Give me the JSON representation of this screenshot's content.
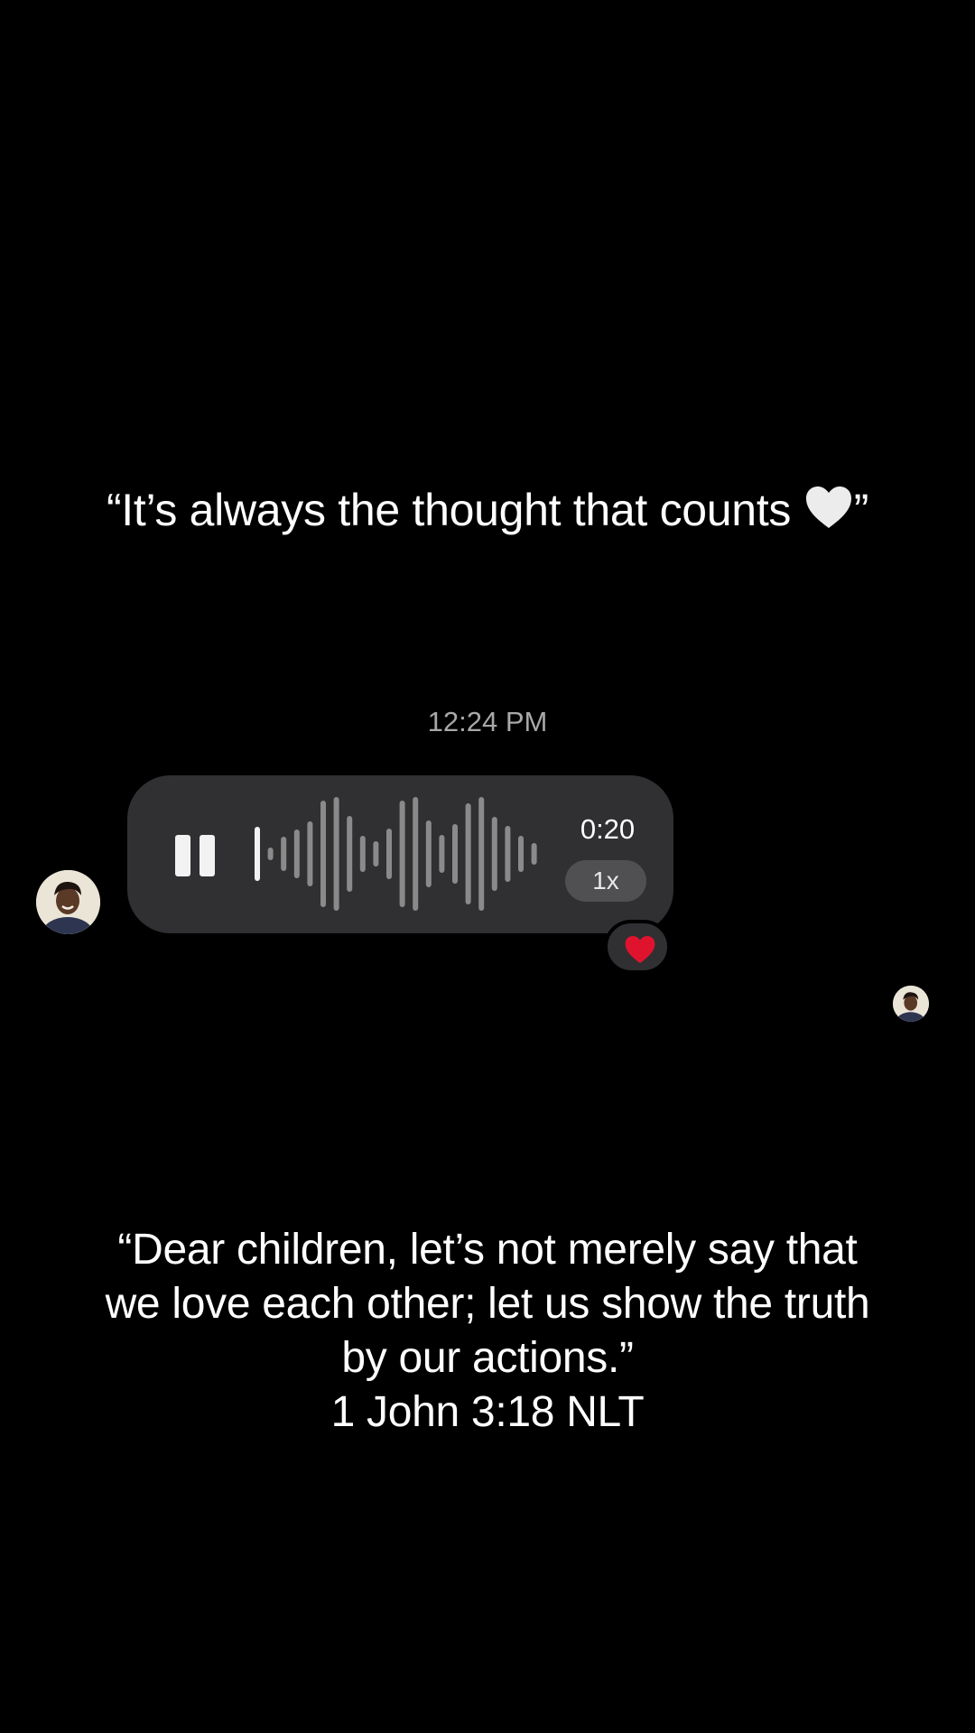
{
  "caption_top": {
    "text_before": "“It’s always the thought that counts ",
    "icon": "white-heart-icon",
    "text_after": "”"
  },
  "thread": {
    "timestamp": "12:24 PM",
    "voice_message": {
      "duration": "0:20",
      "speed": "1x",
      "state": "playing",
      "pause_icon": "pause-icon",
      "reaction_icon": "red-heart-icon"
    }
  },
  "quote": {
    "lines": [
      "“Dear children, let’s not merely say that",
      "we love each other; let us show the truth",
      "by our actions.”",
      "1 John 3:18 NLT"
    ]
  },
  "colors": {
    "background": "#000000",
    "bubble": "#303032",
    "waveform": "#8a8a8a",
    "waveform_played": "#f2f2f2",
    "reaction_heart": "#e0132f"
  }
}
